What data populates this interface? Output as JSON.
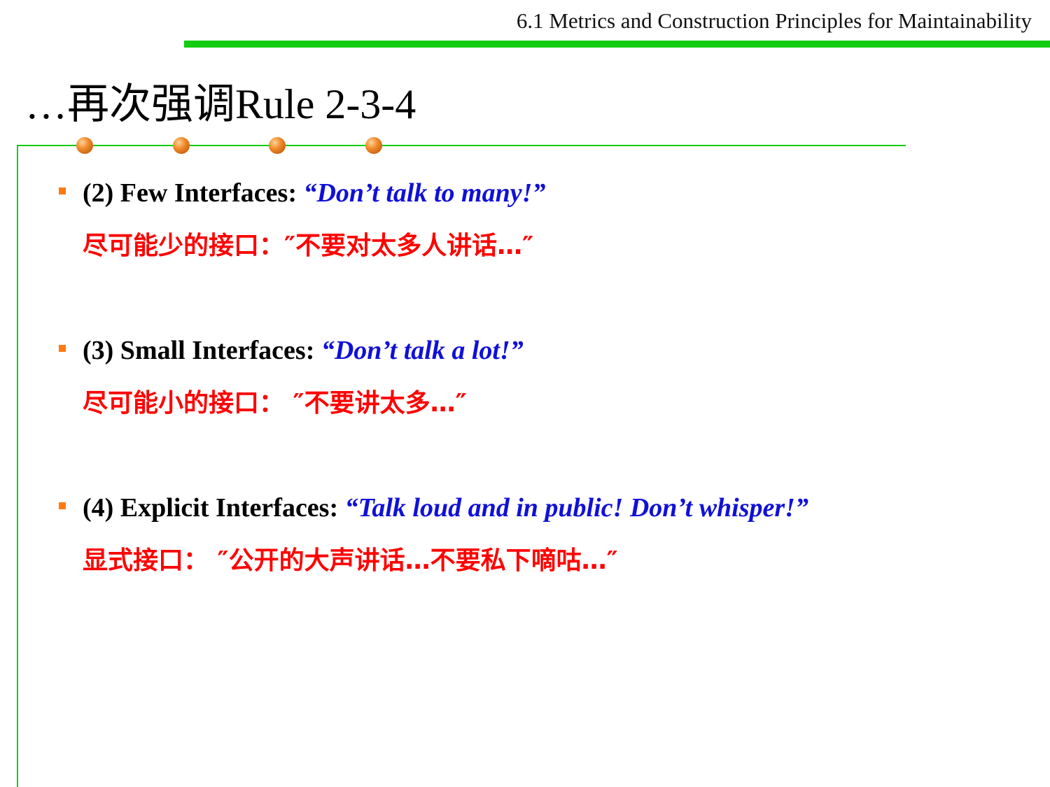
{
  "header": {
    "section": "6.1 Metrics and Construction Principles for Maintainability"
  },
  "title": "…再次强调Rule 2-3-4",
  "bullets": [
    {
      "label": "(2) Few Interfaces:",
      "quote": "“Don’t talk to many!”",
      "chinese": "尽可能少的接口：″不要对太多人讲话…″"
    },
    {
      "label": "(3) Small Interfaces:",
      "quote": "“Don’t talk a lot!”",
      "chinese": "尽可能小的接口： ″不要讲太多…″"
    },
    {
      "label": "(4) Explicit Interfaces:",
      "quote": "“Talk loud and in public!  Don’t whisper!”",
      "chinese": "显式接口： ″公开的大声讲话…不要私下嘀咕…″"
    }
  ],
  "colors": {
    "accent_green": "#11cc11",
    "bullet_orange": "#ff7a10",
    "quote_blue": "#1010d8",
    "chinese_red": "#ff0000"
  }
}
